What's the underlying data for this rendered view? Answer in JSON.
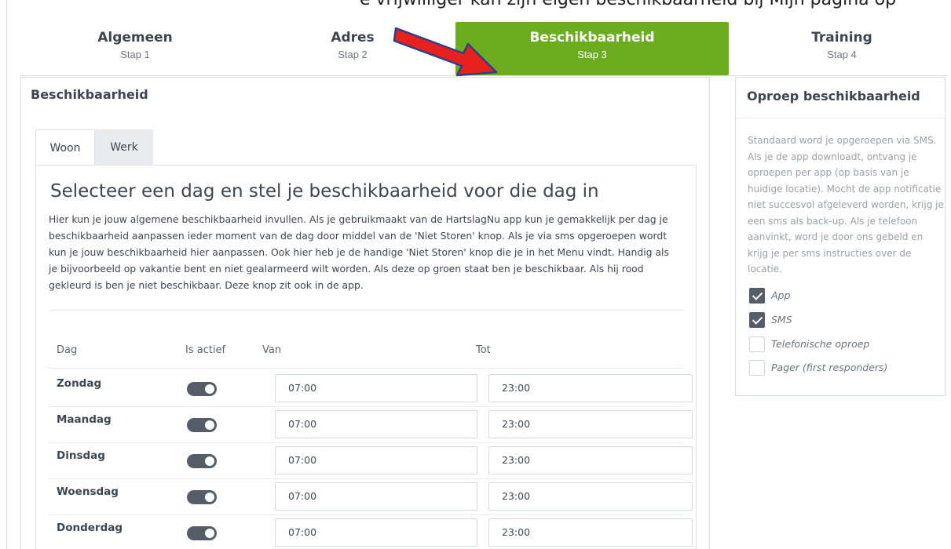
{
  "top_caption": "e vrijwilliger kan zijn eigen beschikbaarheid bij Mijn pagina op",
  "colors": {
    "active_step": "#6bad1f",
    "arrow": "#e8211d",
    "arrow_outline": "#2a3f8f",
    "toggle_on": "#555d68"
  },
  "steps": [
    {
      "title": "Algemeen",
      "sub": "Stap 1",
      "active": false
    },
    {
      "title": "Adres",
      "sub": "Stap 2",
      "active": false
    },
    {
      "title": "Beschikbaarheid",
      "sub": "Stap 3",
      "active": true
    },
    {
      "title": "Training",
      "sub": "Stap 4",
      "active": false
    }
  ],
  "main": {
    "title": "Beschikbaarheid",
    "tabs": [
      {
        "label": "Woon"
      },
      {
        "label": "Werk"
      }
    ],
    "heading": "Selecteer een dag en stel je beschikbaarheid voor die dag in",
    "description": "Hier kun je jouw algemene beschikbaarheid invullen. Als je gebruikmaakt van de HartslagNu app kun je gemakkelijk per dag je beschikbaarheid aanpassen ieder moment van de dag door middel van de 'Niet Storen' knop. Als je via sms opgeroepen wordt kun je jouw beschikbaarheid hier aanpassen. Ook hier heb je de handige 'Niet Storen' knop die je in het Menu vindt. Handig als je bijvoorbeeld op vakantie bent en niet gealarmeerd wilt worden. Als deze op groen staat ben je beschikbaar. Als hij rood gekleurd is ben je niet beschikbaar. Deze knop zit ook in de app.",
    "table": {
      "headers": {
        "dag": "Dag",
        "actief": "Is actief",
        "van": "Van",
        "tot": "Tot"
      },
      "rows": [
        {
          "day": "Zondag",
          "active": true,
          "van": "07:00",
          "tot": "23:00"
        },
        {
          "day": "Maandag",
          "active": true,
          "van": "07:00",
          "tot": "23:00"
        },
        {
          "day": "Dinsdag",
          "active": true,
          "van": "07:00",
          "tot": "23:00"
        },
        {
          "day": "Woensdag",
          "active": true,
          "van": "07:00",
          "tot": "23:00"
        },
        {
          "day": "Donderdag",
          "active": true,
          "van": "07:00",
          "tot": "23:00"
        }
      ]
    }
  },
  "side": {
    "title": "Oproep beschikbaarheid",
    "text": "Standaard word je opgeroepen via SMS. Als je de app downloadt, ontvang je oproepen per app (op basis van je huidige locatie). Mocht de app notificatie niet succesvol afgeleverd worden, krijg je een sms als back-up. Als je telefoon aanvinkt, word je door ons gebeld en krijg je per sms instructies over de locatie.",
    "options": [
      {
        "label": "App",
        "checked": true
      },
      {
        "label": "SMS",
        "checked": true
      },
      {
        "label": "Telefonische oproep",
        "checked": false
      },
      {
        "label": "Pager (first responders)",
        "checked": false
      }
    ]
  }
}
